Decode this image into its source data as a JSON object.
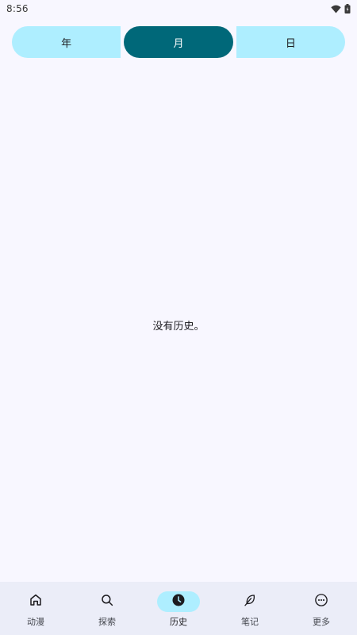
{
  "status_bar": {
    "time": "8:56",
    "icons": [
      "wifi-icon",
      "battery-icon"
    ]
  },
  "tabs": [
    {
      "label": "年",
      "active": false
    },
    {
      "label": "月",
      "active": true
    },
    {
      "label": "日",
      "active": false
    }
  ],
  "main": {
    "empty_message": "没有历史。"
  },
  "bottom_nav": [
    {
      "label": "动漫",
      "icon": "home-icon",
      "active": false
    },
    {
      "label": "探索",
      "icon": "search-icon",
      "active": false
    },
    {
      "label": "历史",
      "icon": "clock-icon",
      "active": true
    },
    {
      "label": "笔记",
      "icon": "feather-icon",
      "active": false
    },
    {
      "label": "更多",
      "icon": "more-icon",
      "active": false
    }
  ],
  "colors": {
    "background": "#f8f7ff",
    "tab_inactive": "#aeeeff",
    "tab_active": "#006879",
    "nav_background": "#ebedf8",
    "nav_active_indicator": "#aeeeff"
  }
}
